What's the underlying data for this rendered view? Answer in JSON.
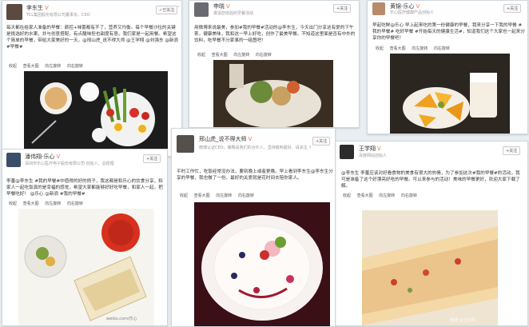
{
  "cards": {
    "c1": {
      "name": "李东生",
      "sub": "TCL集团股份有限公司董事长、CEO",
      "follow": "✓已关注",
      "text": "每天都在给家人准备的早餐：颜控+味蕾都有不了，营养又均衡。每个早餐沙拉的关键是挑选好的水果，并与创意搭配，有点酸味但也甜度有意。我们家是一起用餐。希望这个简单的早餐，带给大家美好的一天。@邢山虎_说不得大师 @王学翔 @刘强东 @新浪 #早餐#",
      "actions": [
        "收起",
        "查看大图",
        "向左旋转",
        "向右旋转"
      ]
    },
    "c2": {
      "name": "申晓",
      "sub": "邀请您体验的早餐活动",
      "follow": "+关注",
      "text": "用微博来说最美，参加#我的早餐#活动的@李东生，今天出门分享这有爱的下午茶，健康美味，我和这一早上好吃，创作了最美早餐。不知道这里面是否有中外的饮料，吃早餐不分家事的一组图吧！",
      "actions": [
        "收起",
        "查看大图",
        "向左旋转",
        "向右旋转"
      ]
    },
    "c3": {
      "name": "邢山虎_说不得大师",
      "sub": "微博认证CEO，策略是我们的合伙人，坚持做到最好，请关注《说不得大师》",
      "follow": "+关注",
      "text": "平时工作忙，吃饭经常没办法，要到晚上或者更晚。早上看到李东生@李东生分享的早餐，我也做了一份，最好的关爱就是花时间去陪你家人。",
      "actions": [
        "收起",
        "查看大图",
        "向左旋转",
        "向右旋转"
      ]
    },
    "c4": {
      "name": "潘伟翔-乐心",
      "sub": "深圳市乐心医疗电子股份有限公司 创始人、总经理",
      "follow": "+关注",
      "text": "李董@李东生 #我的早餐#中值得的好的例子，我这都是和乐心的饮食分享，和家人一起吃饭真的是幸福的感觉，希望大家都能够好好吃早餐，和家人一起，把早餐吃好！ @乐心 @新浪 #我的早餐#",
      "actions": [
        "收起",
        "查看大图",
        "向左旋转",
        "向右旋转"
      ],
      "wm": "weibo.com/乐心"
    },
    "c5": {
      "name": "王学翔",
      "sub": "百度网站创始人",
      "follow": "+关注",
      "text": "@李东生 李董应该对好看食物的美食有很大的热情，为了参加这次#我的早餐#的活动，我可是准备了这个好漂亮好吃的早餐。可以来参与的活动！美味的早餐更好，欢迎大家下载了解。",
      "actions": [
        "收起",
        "查看大图",
        "向左旋转",
        "向右旋转"
      ],
      "wm": "微博 @王学翔"
    },
    "c6": {
      "name": "黄锦-乐心",
      "sub": "乐心医疗健康产品创始人",
      "follow": "+关注",
      "text": "早起吃鲜@乐心 早上起来吃的第一份健康的早餐，我来分享一下我的早餐 #我的早餐# 吃好早餐 #开始每天的健康生活#，知道我们这个大家也一起来分享你的早餐吧！",
      "actions": [
        "收起",
        "查看大图",
        "向左旋转",
        "向右旋转"
      ]
    }
  },
  "colors": {
    "accent": "#eb7350",
    "link": "#eb7350"
  }
}
